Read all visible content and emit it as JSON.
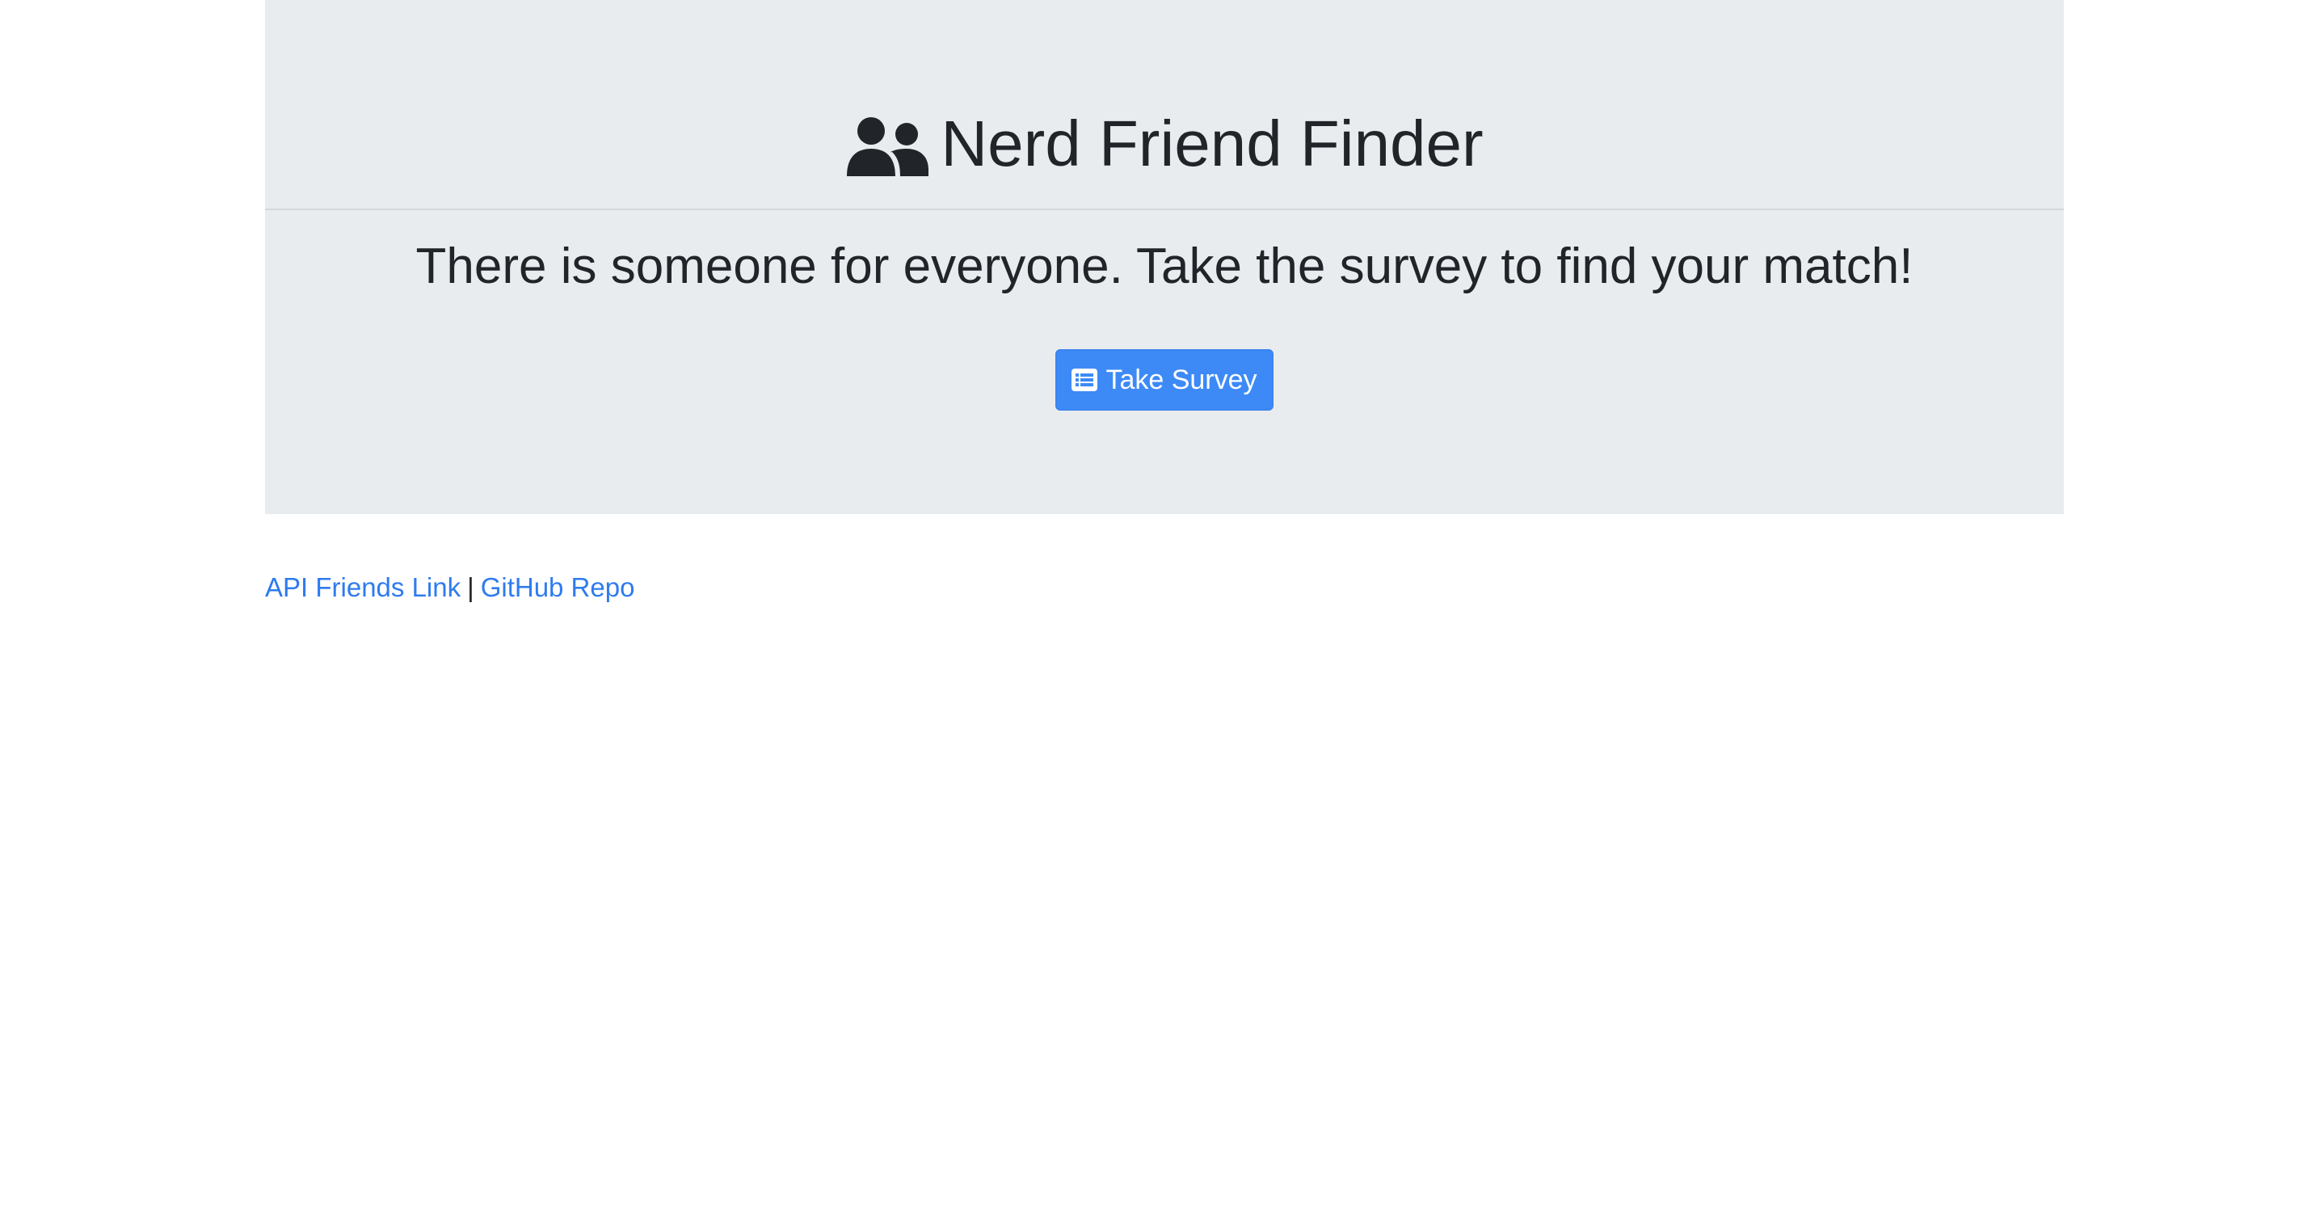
{
  "header": {
    "icon": "users-icon",
    "title": "Nerd Friend Finder",
    "tagline": "There is someone for everyone. Take the survey to find your match!"
  },
  "survey_button": {
    "icon": "list-alt-icon",
    "label": "Take Survey"
  },
  "footer": {
    "api_link_label": "API Friends Link",
    "separator": "|",
    "github_link_label": "GitHub Repo"
  },
  "colors": {
    "jumbotron_bg": "#e9ecef",
    "text": "#212529",
    "primary": "#3d8af7",
    "link": "#2f7bef"
  }
}
